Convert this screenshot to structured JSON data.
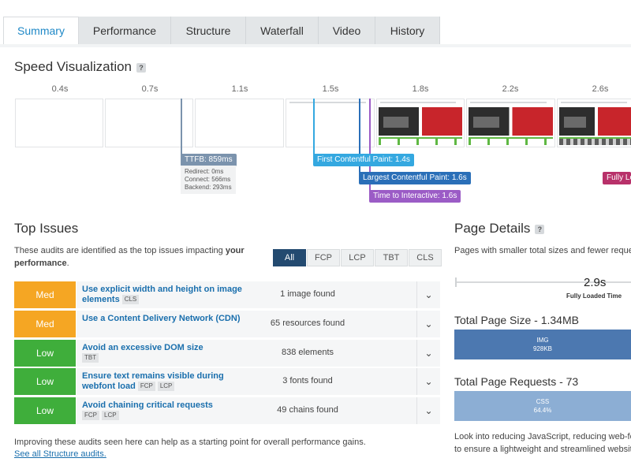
{
  "tabs": [
    {
      "label": "Summary",
      "active": true
    },
    {
      "label": "Performance"
    },
    {
      "label": "Structure"
    },
    {
      "label": "Waterfall"
    },
    {
      "label": "Video"
    },
    {
      "label": "History"
    }
  ],
  "speed": {
    "title": "Speed Visualization",
    "help": "?",
    "ticks": [
      "0.4s",
      "0.7s",
      "1.1s",
      "1.5s",
      "1.8s",
      "2.2s",
      "2.6s"
    ],
    "ttfb": {
      "label": "TTFB: 859ms",
      "redirect": "Redirect: 0ms",
      "connect": "Connect: 566ms",
      "backend": "Backend: 293ms"
    },
    "fcp": "First Contentful Paint: 1.4s",
    "lcp": "Largest Contentful Paint: 1.6s",
    "tti": "Time to Interactive: 1.6s",
    "fully_loaded": "Fully Lo",
    "colors": {
      "ttfb": "#7b93ad",
      "fcp": "#34a8e0",
      "lcp": "#2a6fb8",
      "tti": "#9b5cc6",
      "fully": "#b8316a"
    }
  },
  "issues": {
    "title": "Top Issues",
    "desc_a": "These audits are identified as the top issues impacting ",
    "desc_b": "your",
    "desc_c": "performance",
    "desc_d": ".",
    "filters": [
      "All",
      "FCP",
      "LCP",
      "TBT",
      "CLS"
    ],
    "rows": [
      {
        "severity": "Med",
        "title": "Use explicit width and height on image elements",
        "tags": [
          "CLS"
        ],
        "found": "1 image found"
      },
      {
        "severity": "Med",
        "title": "Use a Content Delivery Network (CDN)",
        "tags": [],
        "found": "65 resources found"
      },
      {
        "severity": "Low",
        "title": "Avoid an excessive DOM size",
        "tags": [
          "TBT"
        ],
        "found": "838 elements"
      },
      {
        "severity": "Low",
        "title": "Ensure text remains visible during webfont load",
        "tags": [
          "FCP",
          "LCP"
        ],
        "found": "3 fonts found"
      },
      {
        "severity": "Low",
        "title": "Avoid chaining critical requests",
        "tags": [
          "FCP",
          "LCP"
        ],
        "found": "49 chains found"
      }
    ],
    "footer": "Improving these audits seen here can help as a starting point for overall performance gains.",
    "link": "See all Structure audits."
  },
  "details": {
    "title": "Page Details",
    "help": "?",
    "desc": "Pages with smaller total sizes and fewer reques",
    "fully_loaded_value": "2.9s",
    "fully_loaded_label": "Fully Loaded Time",
    "size_title": "Total Page Size - 1.34MB",
    "size_bar_label": "IMG",
    "size_bar_value": "928KB",
    "requests_title": "Total Page Requests - 73",
    "requests_bar_label": "CSS",
    "requests_bar_value": "64.4%",
    "footer_1": "Look into reducing JavaScript, reducing web-fo",
    "footer_2": "to ensure a lightweight and streamlined website"
  }
}
